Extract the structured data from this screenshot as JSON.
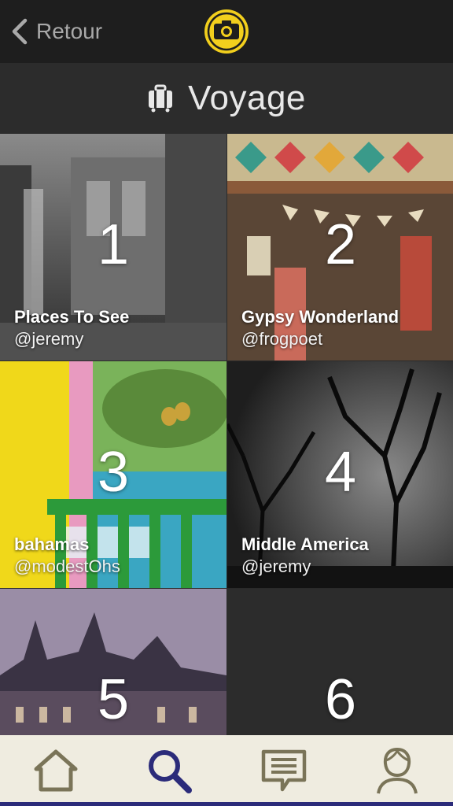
{
  "topbar": {
    "back_label": "Retour",
    "logo_color": "#f2cf1d"
  },
  "header": {
    "title": "Voyage"
  },
  "collections": [
    {
      "number": "1",
      "name": "Places To See",
      "user": "@jeremy"
    },
    {
      "number": "2",
      "name": "Gypsy Wonderland",
      "user": "@frogpoet"
    },
    {
      "number": "3",
      "name": "bahamas",
      "user": "@modestOhs"
    },
    {
      "number": "4",
      "name": "Middle America",
      "user": "@jeremy"
    },
    {
      "number": "5",
      "name": "",
      "user": ""
    },
    {
      "number": "6",
      "name": "",
      "user": ""
    }
  ],
  "tabbar": {
    "items": [
      "home-icon",
      "search-icon",
      "messages-icon",
      "profile-icon"
    ],
    "active": "search-icon",
    "active_color": "#2b2b7a",
    "inactive_color": "#7a7458"
  }
}
